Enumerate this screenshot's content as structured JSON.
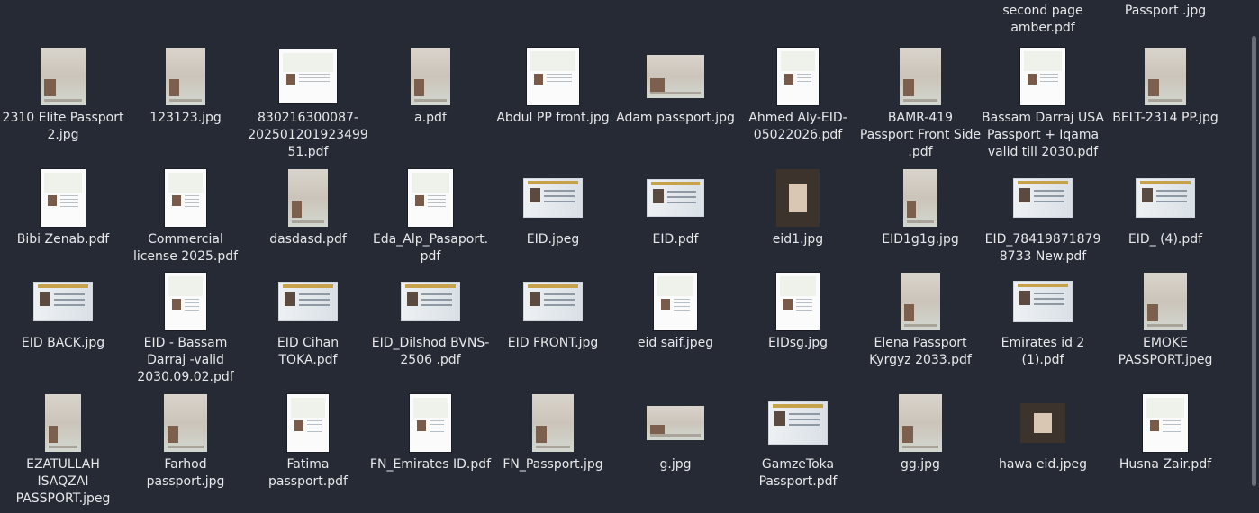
{
  "window": {
    "title": ""
  },
  "top_partial": [
    "second page amber.pdf",
    "Passport .jpg"
  ],
  "rows": [
    [
      "2310 Elite Passport 2.jpg",
      "123123.jpg",
      "830216300087-20250120192349951.pdf",
      "a.pdf",
      "Abdul PP front.jpg",
      "Adam passport.jpg",
      "Ahmed Aly-EID-05022026.pdf",
      "BAMR-419 Passport Front Side .pdf",
      "Bassam Darraj USA Passport + Iqama valid till 2030.pdf",
      "BELT-2314 PP.jpg"
    ],
    [
      "Bibi Zenab.pdf",
      "Commercial license 2025.pdf",
      "dasdasd.pdf",
      "Eda_Alp_Pasaport.pdf",
      "EID.jpeg",
      "EID.pdf",
      "eid1.jpg",
      "EID1g1g.jpg",
      "EID_784198718798733 New.pdf",
      "EID_ (4).pdf"
    ],
    [
      "EID BACK.jpg",
      "EID - Bassam Darraj -valid 2030.09.02.pdf",
      "EID Cihan TOKA.pdf",
      "EID_Dilshod BVNS-2506 .pdf",
      "EID FRONT.jpg",
      "eid saif.jpeg",
      "EIDsg.jpg",
      "Elena Passport Kyrgyz 2033.pdf",
      "Emirates id 2 (1).pdf",
      "EMOKE PASSPORT.jpeg"
    ],
    [
      "EZATULLAH ISAQZAI PASSPORT.jpeg",
      "Farhod passport.jpg",
      "Fatima passport.pdf",
      "FN_Emirates ID.pdf",
      "FN_Passport.jpg",
      "g.jpg",
      "GamzeToka Passport.pdf",
      "gg.jpg",
      "hawa eid.jpeg",
      "Husna Zair.pdf"
    ]
  ],
  "thumb_icons": [
    [
      "passport-photo-icon",
      "passport-photo-icon",
      "document-icon",
      "passport-photo-icon",
      "document-icon",
      "passport-photo-icon",
      "document-icon",
      "passport-photo-icon",
      "document-icon",
      "passport-photo-icon"
    ],
    [
      "document-icon",
      "document-icon",
      "passport-photo-icon",
      "document-icon",
      "id-card-icon",
      "id-card-icon",
      "passport-photo-icon",
      "passport-photo-icon",
      "id-card-icon",
      "id-card-icon"
    ],
    [
      "id-card-icon",
      "document-icon",
      "id-card-icon",
      "id-card-icon",
      "id-card-icon",
      "document-icon",
      "document-icon",
      "passport-photo-icon",
      "id-card-icon",
      "passport-photo-icon"
    ],
    [
      "passport-photo-icon",
      "passport-photo-icon",
      "document-icon",
      "document-icon",
      "passport-photo-icon",
      "passport-photo-icon",
      "id-card-icon",
      "passport-photo-icon",
      "passport-photo-icon",
      "document-icon"
    ]
  ]
}
